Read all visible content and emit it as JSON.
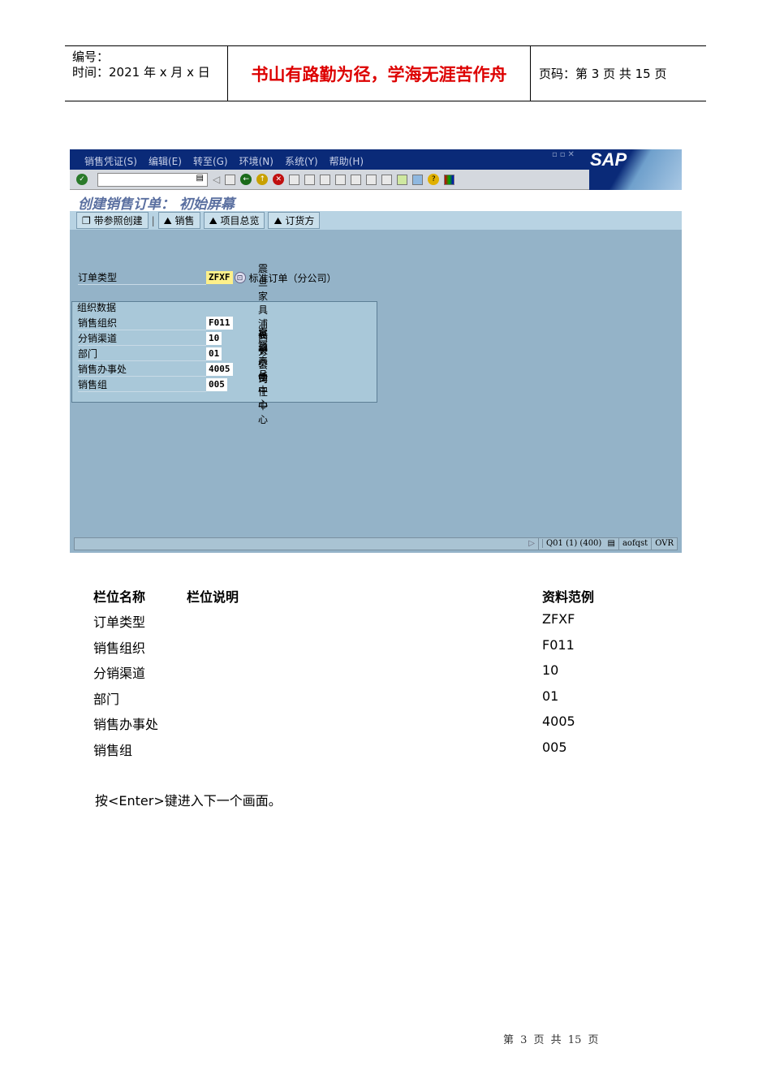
{
  "header": {
    "number_label": "编号：",
    "time_label": "时间：2021 年 x 月 x 日",
    "motto": "书山有路勤为径，学海无涯苦作舟",
    "page_info": "页码：第 3 页  共 15 页"
  },
  "sap": {
    "menu": [
      "销售凭证(S)",
      "编辑(E)",
      "转至(G)",
      "环境(N)",
      "系统(Y)",
      "帮助(H)"
    ],
    "logo": "SAP",
    "title": "创建销售订单：  初始屏幕",
    "app_buttons": [
      "带参照创建",
      "销售",
      "项目总览",
      "订货方"
    ],
    "order_type": {
      "label": "订单类型",
      "value": "ZFXF",
      "desc": "标准订单（分公司）"
    },
    "group_title": "组织数据",
    "org_rows": [
      {
        "label": "销售组织",
        "value": "F011",
        "desc": "震旦家具浦西分公司"
      },
      {
        "label": "分销渠道",
        "value": "10",
        "desc": "直销"
      },
      {
        "label": "部门",
        "value": "01",
        "desc": "家具产品"
      },
      {
        "label": "销售办事处",
        "value": "4005",
        "desc": "长宁责任中心"
      },
      {
        "label": "销售组",
        "value": "005",
        "desc": "长宁责任中心"
      }
    ],
    "status": {
      "system": "Q01 (1) (400)",
      "server": "aofqst",
      "mode": "OVR"
    }
  },
  "table": {
    "headers": [
      "栏位名称",
      "栏位说明",
      "资料范例"
    ],
    "rows": [
      [
        "订单类型",
        "",
        "ZFXF"
      ],
      [
        "销售组织",
        "",
        "F011"
      ],
      [
        "分销渠道",
        "",
        "10"
      ],
      [
        "部门",
        "",
        "01"
      ],
      [
        "销售办事处",
        "",
        "4005"
      ],
      [
        "销售组",
        "",
        "005"
      ]
    ]
  },
  "note": "按<Enter>键进入下一个画面。",
  "footer": "第 3 页 共 15 页"
}
